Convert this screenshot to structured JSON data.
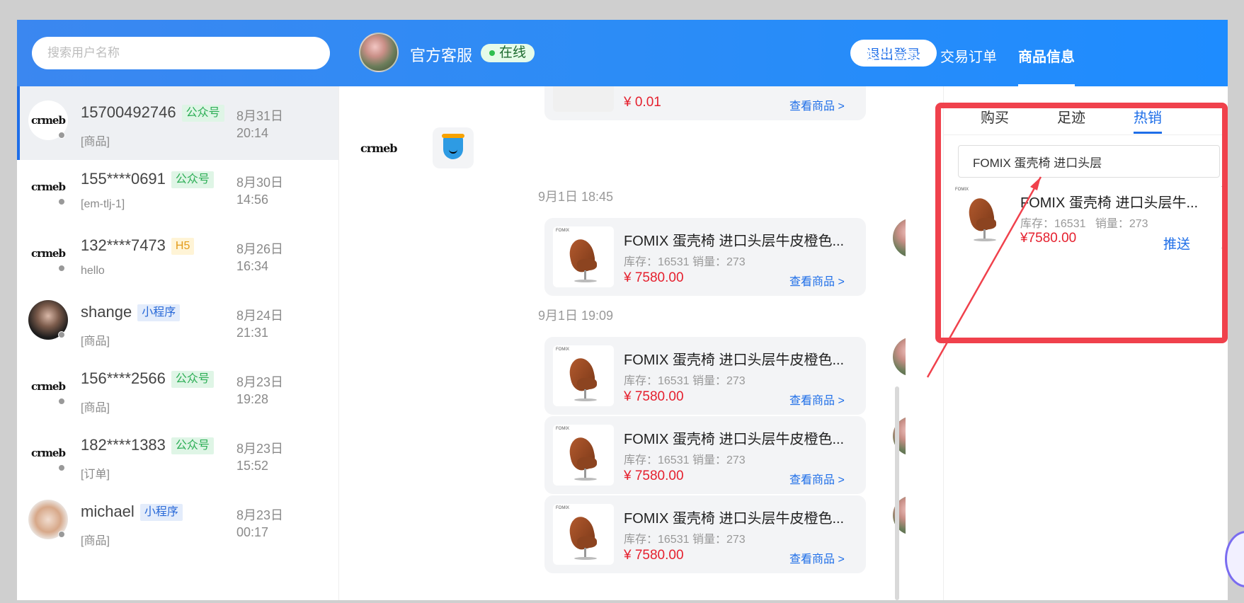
{
  "search": {
    "placeholder": "搜索用户名称"
  },
  "agent": {
    "name": "官方客服",
    "status": "在线"
  },
  "header": {
    "logout_label": "退出登录",
    "tabs": [
      {
        "label": "客户信息"
      },
      {
        "label": "交易订单"
      },
      {
        "label": "商品信息"
      }
    ]
  },
  "sessions": [
    {
      "name": "15700492746",
      "tag": "公众号",
      "preview": "[商品]",
      "date": "8月31日",
      "time": "20:14",
      "avatar": "crmeb"
    },
    {
      "name": "155****0691",
      "tag": "公众号",
      "preview": "[em-tlj-1]",
      "date": "8月30日",
      "time": "14:56",
      "avatar": "crmeb"
    },
    {
      "name": "132****7473",
      "tag": "H5",
      "preview": "hello",
      "date": "8月26日",
      "time": "16:34",
      "avatar": "crmeb"
    },
    {
      "name": "shange",
      "tag": "小程序",
      "preview": "[商品]",
      "date": "8月24日",
      "time": "21:31",
      "avatar": "photo"
    },
    {
      "name": "156****2566",
      "tag": "公众号",
      "preview": "[商品]",
      "date": "8月23日",
      "time": "19:28",
      "avatar": "crmeb"
    },
    {
      "name": "182****1383",
      "tag": "公众号",
      "preview": "[订单]",
      "date": "8月23日",
      "time": "15:52",
      "avatar": "crmeb"
    },
    {
      "name": "michael",
      "tag": "小程序",
      "preview": "[商品]",
      "date": "8月23日",
      "time": "00:17",
      "avatar": "cartoon"
    }
  ],
  "logo_text": "crmeb",
  "chat": {
    "first_bubble": {
      "price": "¥ 0.01",
      "link": "查看商品 >"
    },
    "timestamps": [
      "9月1日 18:45",
      "9月1日 19:09"
    ],
    "product": {
      "brand": "FOMIX",
      "title": "FOMIX 蛋壳椅 进口头层牛皮橙色...",
      "stock": "库存：16531 销量：273",
      "price": "¥ 7580.00",
      "link": "查看商品 >"
    }
  },
  "panel": {
    "tabs": [
      "购买",
      "足迹",
      "热销"
    ],
    "search_value": "FOMIX 蛋壳椅 进口头层",
    "item": {
      "brand": "FOMIX",
      "title": "FOMIX 蛋壳椅 进口头层牛...",
      "stock": "库存：16531",
      "sales": "销量：273",
      "price": "¥7580.00",
      "push": "推送"
    }
  },
  "colors": {
    "accent": "#1e6ee8",
    "price": "#e5202e",
    "highlight": "#f0414c"
  }
}
